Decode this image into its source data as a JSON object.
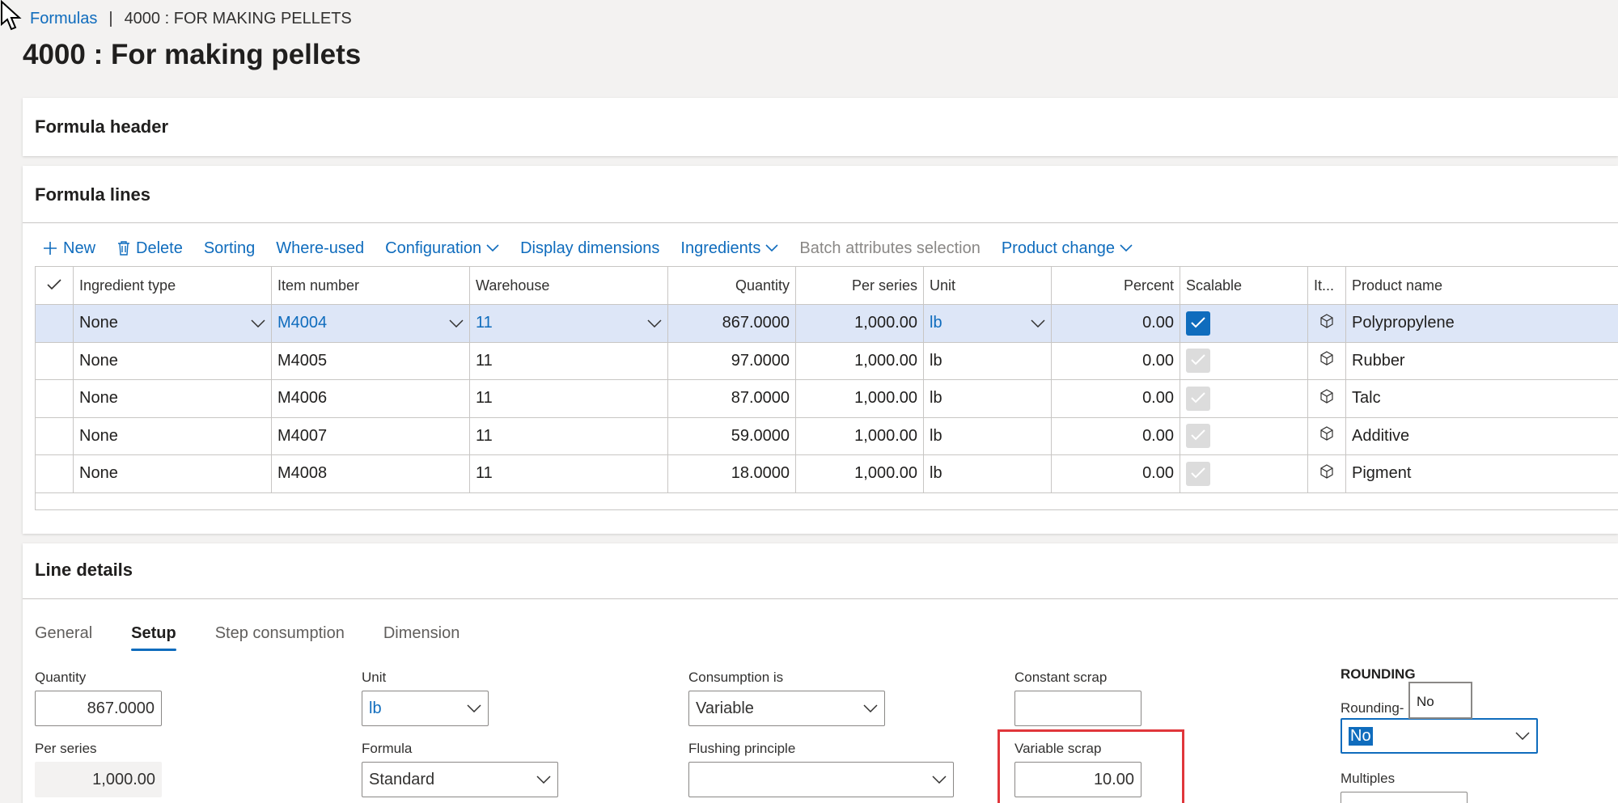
{
  "breadcrumb": {
    "parent": "Formulas",
    "separator": "|",
    "current": "4000 : FOR MAKING PELLETS"
  },
  "page_title": "4000 : For making pellets",
  "formula_header": {
    "title": "Formula header"
  },
  "formula_lines": {
    "title": "Formula lines",
    "toolbar": {
      "new": "New",
      "delete": "Delete",
      "sorting": "Sorting",
      "where_used": "Where-used",
      "configuration": "Configuration",
      "display_dimensions": "Display dimensions",
      "ingredients": "Ingredients",
      "batch_attributes": "Batch attributes selection",
      "product_change": "Product change"
    },
    "columns": {
      "ingredient_type": "Ingredient type",
      "item_number": "Item number",
      "warehouse": "Warehouse",
      "quantity": "Quantity",
      "per_series": "Per series",
      "unit": "Unit",
      "percent": "Percent",
      "scalable": "Scalable",
      "item": "It...",
      "product_name": "Product name"
    },
    "rows": [
      {
        "ingredient_type": "None",
        "item_number": "M4004",
        "warehouse": "11",
        "quantity": "867.0000",
        "per_series": "1,000.00",
        "unit": "lb",
        "percent": "0.00",
        "scalable": true,
        "product_name": "Polypropylene"
      },
      {
        "ingredient_type": "None",
        "item_number": "M4005",
        "warehouse": "11",
        "quantity": "97.0000",
        "per_series": "1,000.00",
        "unit": "lb",
        "percent": "0.00",
        "scalable": false,
        "product_name": "Rubber"
      },
      {
        "ingredient_type": "None",
        "item_number": "M4006",
        "warehouse": "11",
        "quantity": "87.0000",
        "per_series": "1,000.00",
        "unit": "lb",
        "percent": "0.00",
        "scalable": false,
        "product_name": "Talc"
      },
      {
        "ingredient_type": "None",
        "item_number": "M4007",
        "warehouse": "11",
        "quantity": "59.0000",
        "per_series": "1,000.00",
        "unit": "lb",
        "percent": "0.00",
        "scalable": false,
        "product_name": "Additive"
      },
      {
        "ingredient_type": "None",
        "item_number": "M4008",
        "warehouse": "11",
        "quantity": "18.0000",
        "per_series": "1,000.00",
        "unit": "lb",
        "percent": "0.00",
        "scalable": false,
        "product_name": "Pigment"
      }
    ]
  },
  "line_details": {
    "title": "Line details",
    "tabs": [
      "General",
      "Setup",
      "Step consumption",
      "Dimension"
    ],
    "active_tab": "Setup",
    "fields": {
      "quantity": {
        "label": "Quantity",
        "value": "867.0000"
      },
      "per_series": {
        "label": "Per series",
        "value": "1,000.00"
      },
      "unit": {
        "label": "Unit",
        "value": "lb"
      },
      "formula": {
        "label": "Formula",
        "value": "Standard"
      },
      "consumption_is": {
        "label": "Consumption is",
        "value": "Variable"
      },
      "flushing_principle": {
        "label": "Flushing principle",
        "value": ""
      },
      "constant_scrap": {
        "label": "Constant scrap",
        "value": ""
      },
      "variable_scrap": {
        "label": "Variable scrap",
        "value": "10.00"
      },
      "rounding_title": "ROUNDING",
      "rounding": {
        "label": "Rounding-",
        "tooltip": "No",
        "value": "No"
      },
      "multiples": {
        "label": "Multiples"
      }
    }
  },
  "colors": {
    "accent": "#0f6cbd",
    "highlight": "#e0363b",
    "selected_row": "#dde6f7"
  }
}
